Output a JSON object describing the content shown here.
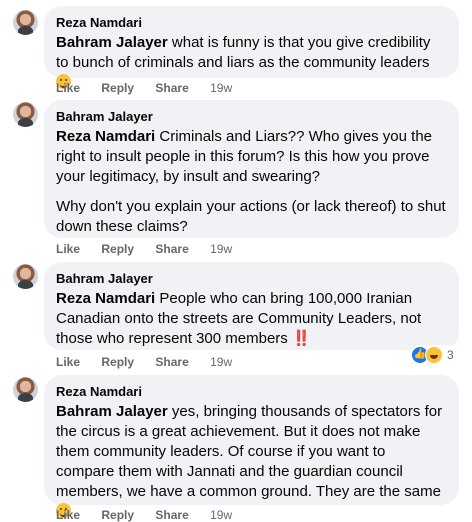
{
  "top_crop_text": "• • • ...",
  "actions": {
    "like": "Like",
    "reply": "Reply",
    "share": "Share"
  },
  "comments": [
    {
      "author": "Reza Namdari",
      "mention": "Bahram Jalayer",
      "text": " what is funny is that you give credibility to bunch of criminals and liars as the community leaders ",
      "emoji": "rolling-on-floor-laughing-emoji",
      "time": "19w"
    },
    {
      "author": "Bahram Jalayer",
      "mention": "Reza Namdari",
      "text": " Criminals and Liars?? Who gives you the right to insult people in this forum? Is this how you prove your legitimacy, by insult and swearing?",
      "text2": "Why don't you explain your actions (or lack thereof) to shut down these claims?",
      "time": "19w"
    },
    {
      "author": "Bahram Jalayer",
      "mention": "Reza Namdari",
      "text": " People who can bring 100,000 Iranian Canadian onto the streets are Community Leaders, not those who represent 300 members ‼️",
      "time": "19w",
      "reaction_count": "3",
      "reaction_icons": [
        "like-reaction-icon",
        "haha-reaction-icon"
      ]
    },
    {
      "author": "Reza Namdari",
      "mention": "Bahram Jalayer",
      "text": " yes, bringing thousands of spectators for the circus is a great achievement. But it does not make them community leaders. Of course if you want to compare them with Jannati and the guardian council members, we have a common ground. They are the same ",
      "emoji": "smiling-face-emoji",
      "time": "19w"
    }
  ]
}
